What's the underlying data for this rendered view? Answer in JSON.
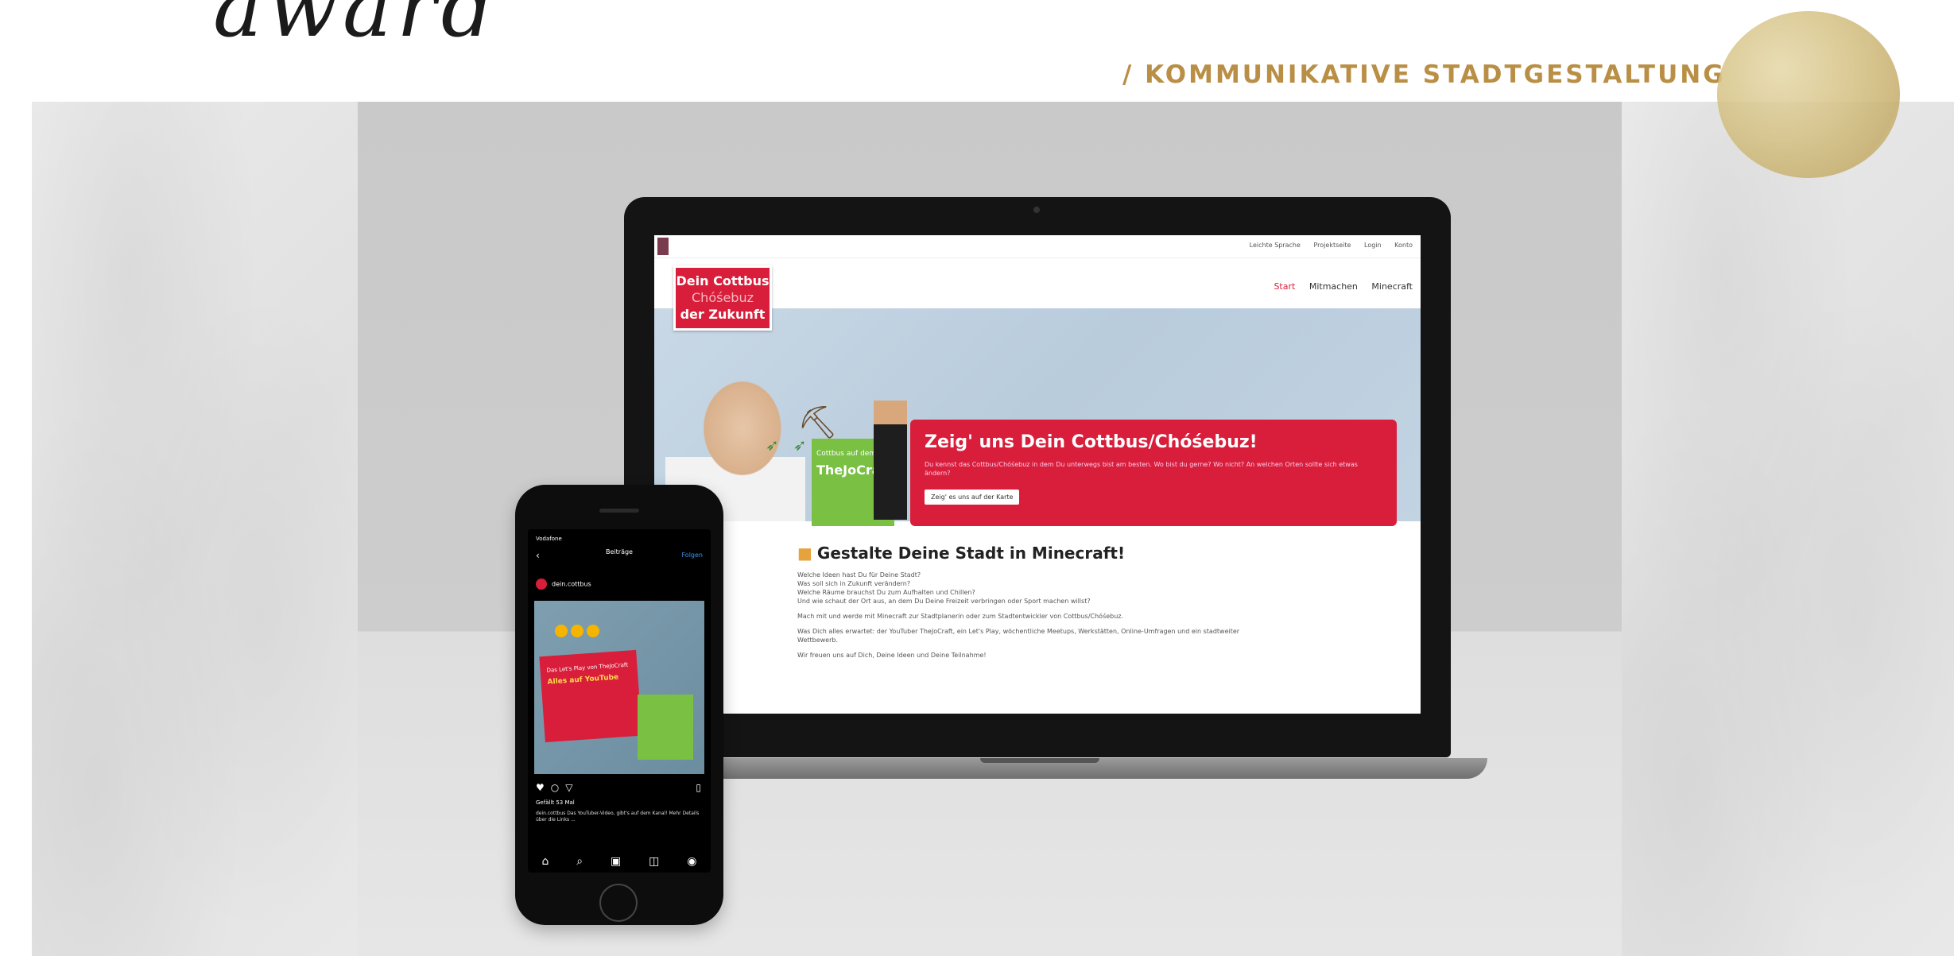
{
  "header": {
    "script_title": "award",
    "category": "/ KOMMUNIKATIVE STADTGESTALTUNG"
  },
  "website": {
    "top_links": [
      "Leichte Sprache",
      "Projektseite",
      "Login",
      "Konto"
    ],
    "logo": {
      "line1": "Dein Cottbus",
      "line2": "Chóśebuz",
      "line3": "der Zukunft"
    },
    "nav": [
      "Start",
      "Mitmachen",
      "Minecraft"
    ],
    "board_text": "Cottbus auf dem",
    "board_name": "TheJoCraft",
    "cta": {
      "title": "Zeig' uns Dein Cottbus/Chóśebuz!",
      "text": "Du kennst das Cottbus/Chóśebuz in dem Du unterwegs bist am besten. Wo bist du gerne? Wo nicht? An welchen Orten sollte sich etwas ändern?",
      "button": "Zeig' es uns auf der Karte"
    },
    "content_title": "Gestalte Deine Stadt in Minecraft!",
    "paragraphs": [
      "Welche Ideen hast Du für Deine Stadt?",
      "Was soll sich in Zukunft verändern?",
      "Welche Räume brauchst Du zum Aufhalten und Chillen?",
      "Und wie schaut der Ort aus, an dem Du Deine Freizeit verbringen oder Sport machen willst?",
      "Mach mit und werde mit Minecraft zur Stadtplanerin oder zum Stadtentwickler von Cottbus/Chóśebuz.",
      "Was Dich alles erwartet: der YouTuber TheJoCraft, ein Let's Play, wöchentliche Meetups, Werkstätten, Online-Umfragen und ein stadtweiter Wettbewerb.",
      "Wir freuen uns auf Dich, Deine Ideen und Deine Teilnahme!"
    ]
  },
  "phone": {
    "status": "Vodafone",
    "header_title": "Beiträge",
    "follow": "Folgen",
    "account": "dein.cottbus",
    "card_line": "Das Let's Play von TheJoCraft",
    "card_highlight": "Alles auf YouTube",
    "likes": "Gefällt 53 Mal",
    "caption": "dein.cottbus Das YouTuber-Video, gibt's auf dem Kanal! Mehr Details über die Links ..."
  }
}
